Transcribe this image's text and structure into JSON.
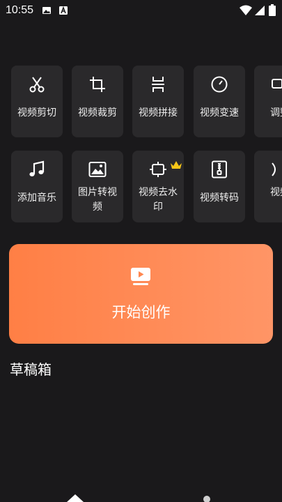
{
  "status_bar": {
    "time": "10:55",
    "icons": [
      "image-icon",
      "a-letter-icon",
      "wifi-icon",
      "signal-icon",
      "battery-icon"
    ]
  },
  "tools_row1": [
    {
      "label": "视频剪切",
      "icon": "scissors-icon"
    },
    {
      "label": "视频裁剪",
      "icon": "crop-icon"
    },
    {
      "label": "视频拼接",
      "icon": "merge-icon"
    },
    {
      "label": "视频变速",
      "icon": "speed-gauge-icon"
    },
    {
      "label": "调整",
      "icon": "adjust-icon"
    }
  ],
  "tools_row2": [
    {
      "label": "添加音乐",
      "icon": "music-note-icon"
    },
    {
      "label": "图片转视频",
      "icon": "image-icon"
    },
    {
      "label": "视频去水印",
      "icon": "watermark-remove-icon",
      "badge": "crown-icon"
    },
    {
      "label": "视频转码",
      "icon": "zip-file-icon"
    },
    {
      "label": "视频",
      "icon": "partial-icon"
    }
  ],
  "create": {
    "label": "开始创作",
    "icon": "video-play-icon"
  },
  "drafts": {
    "title": "草稿箱"
  },
  "colors": {
    "background": "#1a191b",
    "card": "#2a292b",
    "accent_start": "#ff7f45",
    "accent_end": "#ff9566",
    "crown": "#f5c518"
  }
}
